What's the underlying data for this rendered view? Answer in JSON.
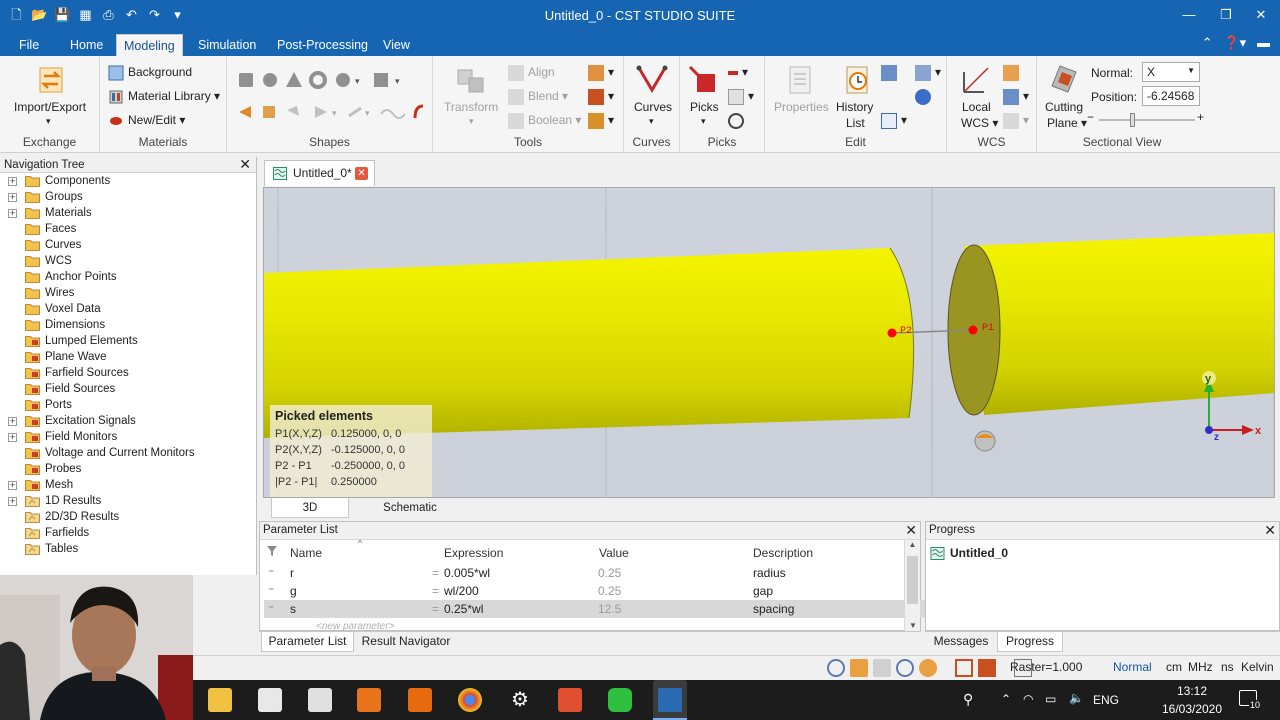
{
  "window": {
    "title": "Untitled_0 - CST STUDIO SUITE"
  },
  "menu": {
    "tabs": [
      "File",
      "Home",
      "Modeling",
      "Simulation",
      "Post-Processing",
      "View"
    ],
    "active": "Modeling"
  },
  "ribbon": {
    "exchange": {
      "label": "Exchange",
      "import_export": "Import/Export"
    },
    "materials": {
      "label": "Materials",
      "background": "Background",
      "material_library": "Material Library",
      "new_edit": "New/Edit"
    },
    "shapes": {
      "label": "Shapes"
    },
    "tools": {
      "label": "Tools",
      "transform": "Transform",
      "align": "Align",
      "blend": "Blend",
      "boolean": "Boolean"
    },
    "curves": {
      "label": "Curves",
      "curves": "Curves"
    },
    "picks": {
      "label": "Picks",
      "picks": "Picks"
    },
    "edit": {
      "label": "Edit",
      "properties": "Properties",
      "history_list_1": "History",
      "history_list_2": "List"
    },
    "wcs": {
      "label": "WCS",
      "local_wcs_1": "Local",
      "local_wcs_2": "WCS"
    },
    "sectional": {
      "label": "Sectional View",
      "cutting_plane_1": "Cutting",
      "cutting_plane_2": "Plane",
      "normal_label": "Normal:",
      "normal_value": "X",
      "position_label": "Position:",
      "position_value": "-6.24568"
    }
  },
  "navtree": {
    "title": "Navigation Tree",
    "items": [
      {
        "label": "Components",
        "expandable": true,
        "icon": "folder-icon"
      },
      {
        "label": "Groups",
        "expandable": true,
        "icon": "folder-icon"
      },
      {
        "label": "Materials",
        "expandable": true,
        "icon": "folder-icon"
      },
      {
        "label": "Faces",
        "expandable": false,
        "icon": "folder-icon"
      },
      {
        "label": "Curves",
        "expandable": false,
        "icon": "folder-icon"
      },
      {
        "label": "WCS",
        "expandable": false,
        "icon": "folder-icon"
      },
      {
        "label": "Anchor Points",
        "expandable": false,
        "icon": "folder-icon"
      },
      {
        "label": "Wires",
        "expandable": false,
        "icon": "folder-icon"
      },
      {
        "label": "Voxel Data",
        "expandable": false,
        "icon": "folder-icon"
      },
      {
        "label": "Dimensions",
        "expandable": false,
        "icon": "folder-icon"
      },
      {
        "label": "Lumped Elements",
        "expandable": false,
        "icon": "component-folder-icon"
      },
      {
        "label": "Plane Wave",
        "expandable": false,
        "icon": "component-folder-icon"
      },
      {
        "label": "Farfield Sources",
        "expandable": false,
        "icon": "component-folder-icon"
      },
      {
        "label": "Field Sources",
        "expandable": false,
        "icon": "component-folder-icon"
      },
      {
        "label": "Ports",
        "expandable": false,
        "icon": "component-folder-icon"
      },
      {
        "label": "Excitation Signals",
        "expandable": true,
        "icon": "component-folder-icon"
      },
      {
        "label": "Field Monitors",
        "expandable": true,
        "icon": "component-folder-icon"
      },
      {
        "label": "Voltage and Current Monitors",
        "expandable": false,
        "icon": "component-folder-icon"
      },
      {
        "label": "Probes",
        "expandable": false,
        "icon": "component-folder-icon"
      },
      {
        "label": "Mesh",
        "expandable": true,
        "icon": "component-folder-icon"
      },
      {
        "label": "1D Results",
        "expandable": true,
        "icon": "results-folder-icon"
      },
      {
        "label": "2D/3D Results",
        "expandable": false,
        "icon": "results-folder-icon"
      },
      {
        "label": "Farfields",
        "expandable": false,
        "icon": "results-folder-icon"
      },
      {
        "label": "Tables",
        "expandable": false,
        "icon": "results-folder-icon"
      }
    ]
  },
  "document": {
    "tab": "Untitled_0*"
  },
  "viewport": {
    "points": {
      "p1": "P1",
      "p2": "P2"
    },
    "axes": {
      "x": "x",
      "y": "y",
      "z": "z"
    },
    "picked": {
      "title": "Picked elements",
      "rows": [
        {
          "key": "P1(X,Y,Z)",
          "value": "0.125000, 0, 0"
        },
        {
          "key": "P2(X,Y,Z)",
          "value": "-0.125000, 0, 0"
        },
        {
          "key": "P2 - P1",
          "value": "-0.250000, 0, 0"
        },
        {
          "key": "|P2 - P1|",
          "value": "0.250000"
        }
      ]
    },
    "view_tabs": [
      "3D",
      "Schematic"
    ],
    "active_view": "3D",
    "colors": {
      "cylinder": "#e6e600",
      "point": "#ff0000"
    }
  },
  "params": {
    "title": "Parameter List",
    "columns": [
      "Name",
      "Expression",
      "Value",
      "Description"
    ],
    "rows": [
      {
        "name": "r",
        "expression": "0.005*wl",
        "value": "0.25",
        "description": "radius",
        "selected": false
      },
      {
        "name": "g",
        "expression": "wl/200",
        "value": "0.25",
        "description": "gap",
        "selected": false
      },
      {
        "name": "s",
        "expression": "0.25*wl",
        "value": "12.5",
        "description": "spacing",
        "selected": true
      }
    ],
    "new_param": "<new parameter>",
    "tabs": [
      "Parameter List",
      "Result Navigator"
    ]
  },
  "progress": {
    "title": "Progress",
    "item": "Untitled_0",
    "tabs": [
      "Messages",
      "Progress"
    ]
  },
  "status": {
    "raster": "Raster=1.000",
    "mode": "Normal",
    "units": [
      "cm",
      "MHz",
      "ns",
      "Kelvin"
    ]
  },
  "taskbar": {
    "lang": "ENG",
    "time": "13:12",
    "date": "16/03/2020",
    "notifications": "10"
  }
}
